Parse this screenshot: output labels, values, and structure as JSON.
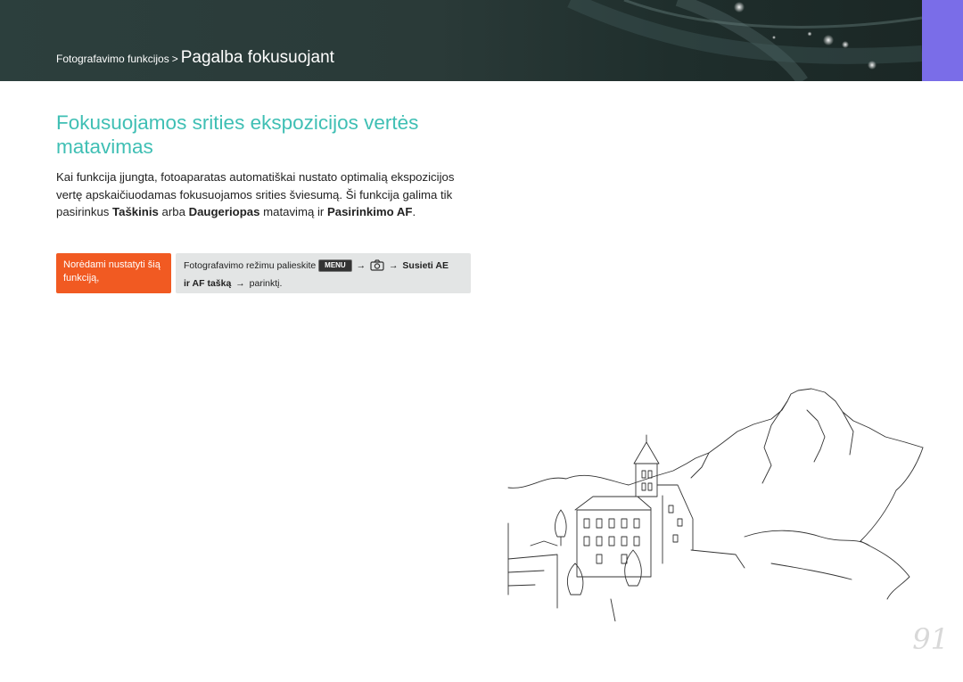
{
  "header": {
    "breadcrumb_section": "Fotografavimo funkcijos",
    "breadcrumb_separator": ">",
    "breadcrumb_current": "Pagalba fokusuojant"
  },
  "section": {
    "title": "Fokusuojamos srities ekspozicijos vertės matavimas",
    "paragraph_parts": [
      "Kai funkcija įjungta, fotoaparatas automatiškai nustato optimalią ekspozicijos vertę apskaičiuodamas fokusuojamos srities šviesumą. Ši funkcija galima tik pasirinkus ",
      "Taškinis",
      " arba ",
      "Daugeriopas",
      " matavimą ir ",
      "Pasirinkimo AF",
      "."
    ]
  },
  "howto": {
    "label": "Norėdami nustatyti šią funkciją,",
    "prefix": "Fotografavimo režimu palieskite",
    "menu_key": "MENU",
    "arrow": "→",
    "option_line1": "Susieti AE",
    "option_line2": "ir AF tašką",
    "suffix": "parinktį."
  },
  "page_number": "91",
  "colors": {
    "title": "#3fbfb4",
    "howto_label_bg": "#f15a22",
    "side_tab": "#7a6de8",
    "header_bg": "#2c3f3d"
  },
  "icons": [
    "camera-icon",
    "menu-key-icon"
  ]
}
